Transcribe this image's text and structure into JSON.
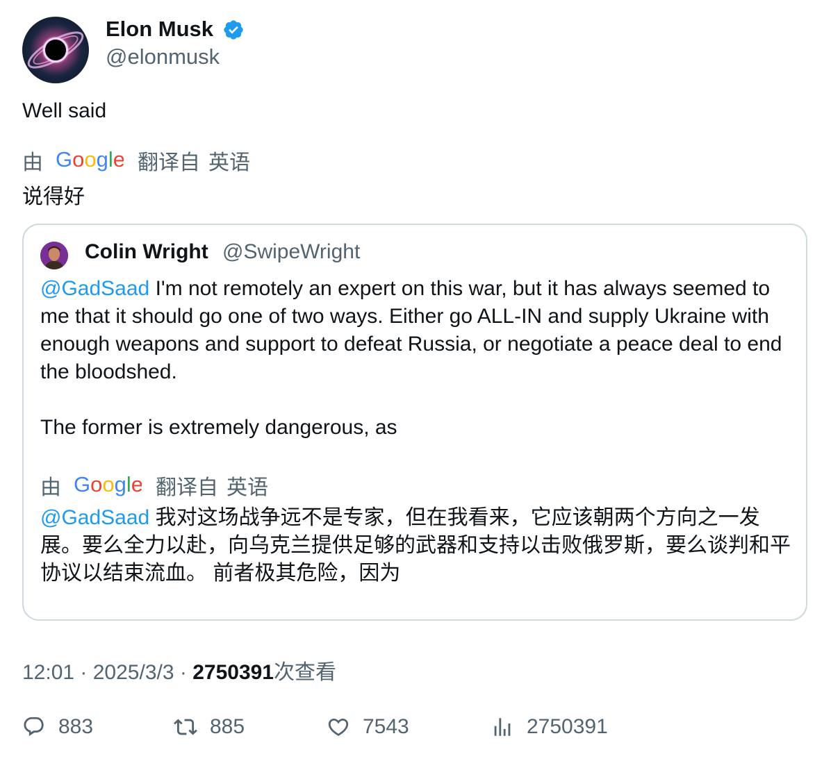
{
  "author": {
    "name": "Elon Musk",
    "handle": "@elonmusk",
    "verified": true
  },
  "tweet": {
    "text": "Well said",
    "translation_by": "由",
    "translation_from": "翻译自",
    "translation_lang": "英语",
    "translated_text": "说得好"
  },
  "quote": {
    "name": "Colin Wright",
    "handle": "@SwipeWright",
    "mention": "@GadSaad",
    "text_p1": " I'm not remotely an expert on this war, but it has always seemed to me that it should go one of two ways. Either go ALL-IN and supply Ukraine with enough weapons and support to defeat Russia, or negotiate a peace deal to end the bloodshed.",
    "text_p2": "The former is extremely dangerous, as",
    "translation_by": "由",
    "translation_from": "翻译自",
    "translation_lang": "英语",
    "translated_mention": "@GadSaad",
    "translated_text": " 我对这场战争远不是专家，但在我看来，它应该朝两个方向之一发展。要么全力以赴，向乌克兰提供足够的武器和支持以击败俄罗斯，要么谈判和平协议以结束流血。 前者极其危险，因为"
  },
  "meta": {
    "time": "12:01",
    "sep": " · ",
    "date": "2025/3/3",
    "views_count": "2750391",
    "views_label": "次查看"
  },
  "actions": {
    "replies": "883",
    "retweets": "885",
    "likes": "7543",
    "views": "2750391"
  },
  "colors": {
    "accent": "#1d9bf0",
    "text": "#0f1419",
    "secondary": "#536471",
    "border": "#cfd9de"
  },
  "icons": [
    "verified-badge-icon",
    "google-logo",
    "reply-icon",
    "retweet-icon",
    "like-icon",
    "views-icon"
  ]
}
